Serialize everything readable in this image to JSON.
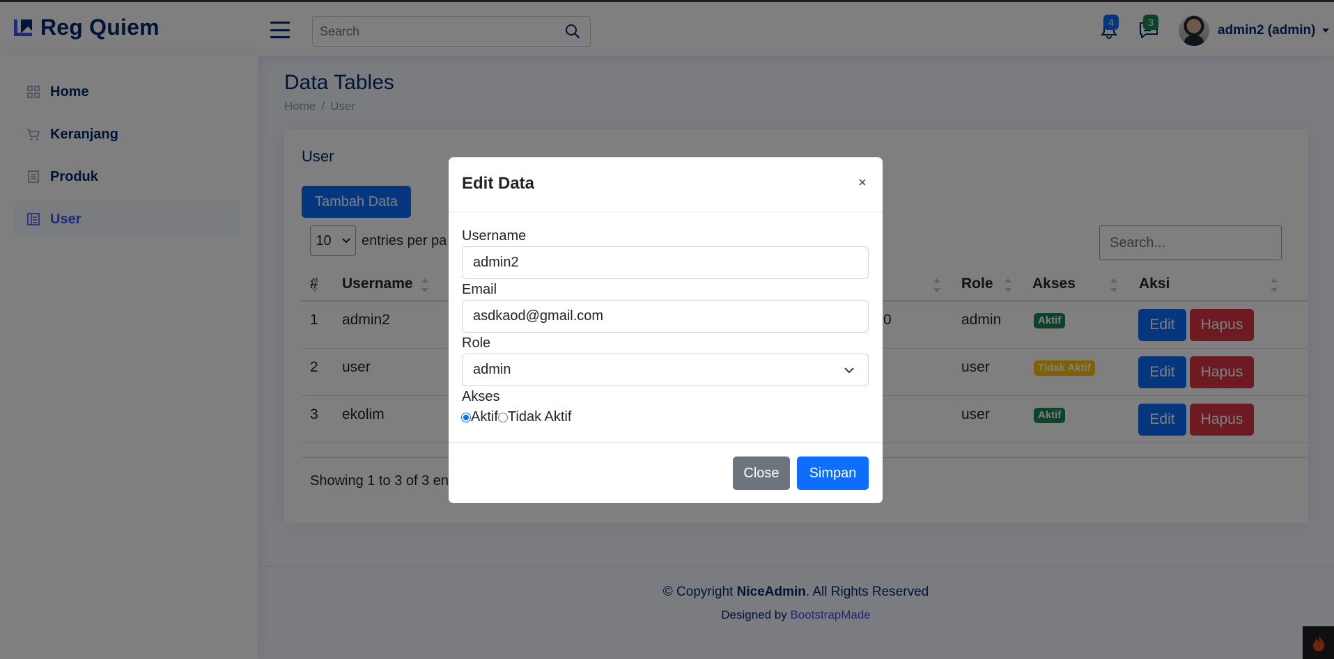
{
  "brand": {
    "name": "Reg Quiem",
    "accent": "#4154f1",
    "navy": "#012970"
  },
  "header": {
    "search_placeholder": "Search",
    "notifications_count": "4",
    "messages_count": "3",
    "user_label": "admin2 (admin)"
  },
  "sidebar": {
    "items": [
      {
        "label": "Home",
        "icon": "grid-icon"
      },
      {
        "label": "Keranjang",
        "icon": "cart-icon"
      },
      {
        "label": "Produk",
        "icon": "receipt-icon"
      },
      {
        "label": "User",
        "icon": "layout-text-icon",
        "active": true
      }
    ]
  },
  "page": {
    "title": "Data Tables",
    "breadcrumb": [
      "Home",
      "/",
      "User"
    ]
  },
  "card": {
    "title": "User",
    "add_button": "Tambah Data",
    "per_page_value": "10",
    "per_page_label": "entries per pa",
    "search_placeholder": "Search...",
    "columns": [
      "#",
      "Username",
      "Role",
      "Akses",
      "Aksi"
    ],
    "rows": [
      {
        "no": "1",
        "username": "admin2",
        "hidden_tail": "0",
        "role": "admin",
        "akses": "Aktif",
        "status": "ok"
      },
      {
        "no": "2",
        "username": "user",
        "hidden_tail": "",
        "role": "user",
        "akses": "Tidak Aktif",
        "status": "warn"
      },
      {
        "no": "3",
        "username": "ekolim",
        "hidden_tail": "",
        "role": "user",
        "akses": "Aktif",
        "status": "ok"
      }
    ],
    "edit_label": "Edit",
    "delete_label": "Hapus",
    "showing": "Showing 1 to 3 of 3 en"
  },
  "footer": {
    "copyright_prefix": "© Copyright ",
    "copyright_brand": "NiceAdmin",
    "copyright_suffix": ". All Rights Reserved",
    "credits_prefix": "Designed by ",
    "credits_link": "BootstrapMade"
  },
  "modal": {
    "title": "Edit Data",
    "username_label": "Username",
    "username_value": "admin2",
    "email_label": "Email",
    "email_value": "asdkaod@gmail.com",
    "role_label": "Role",
    "role_value": "admin",
    "akses_label": "Akses",
    "akses_options": [
      "Aktif",
      "Tidak Aktif"
    ],
    "akses_selected": "Aktif",
    "close_button": "Close",
    "save_button": "Simpan"
  },
  "colors": {
    "primary": "#0d6efd",
    "danger": "#dc3545",
    "secondary": "#6c757d",
    "success": "#198754",
    "warning": "#ffc107"
  }
}
